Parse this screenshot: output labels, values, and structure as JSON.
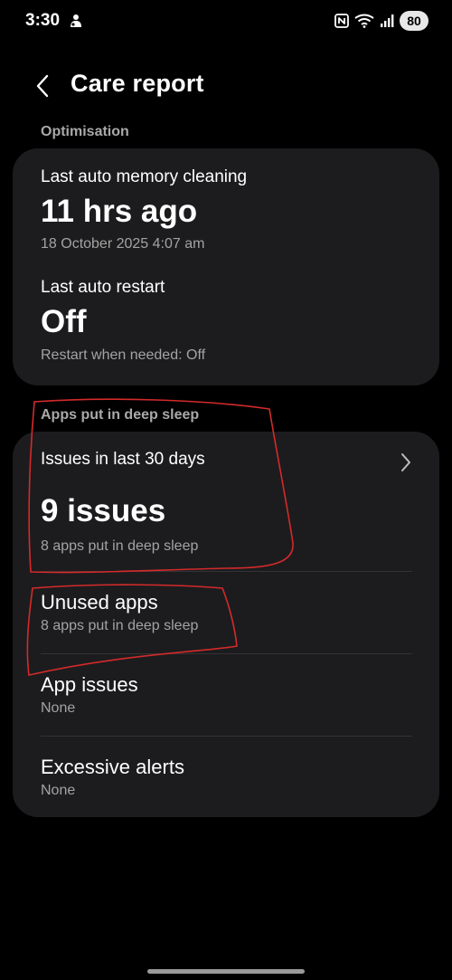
{
  "status_bar": {
    "time": "3:30",
    "left_icon": "notification-icon",
    "nfc_icon": "nfc-icon",
    "wifi_icon": "wifi-icon",
    "signal_icon": "signal-icon",
    "battery": "80"
  },
  "header": {
    "back_icon": "back-arrow-icon",
    "title": "Care report"
  },
  "optimisation": {
    "section_label": "Optimisation",
    "memory_cleaning": {
      "label": "Last auto memory cleaning",
      "value": "11 hrs ago",
      "detail": "18 October 2025 4:07 am"
    },
    "auto_restart": {
      "label": "Last auto restart",
      "value": "Off",
      "detail": "Restart when needed: Off"
    }
  },
  "deep_sleep": {
    "section_label": "Apps put in deep sleep",
    "issues": {
      "label": "Issues in last 30 days",
      "value": "9 issues",
      "detail": "8 apps put in deep sleep",
      "chevron_icon": "chevron-right-icon"
    },
    "items": [
      {
        "title": "Unused apps",
        "subtitle": "8 apps put in deep sleep"
      },
      {
        "title": "App issues",
        "subtitle": "None"
      },
      {
        "title": "Excessive alerts",
        "subtitle": "None"
      }
    ]
  },
  "colors": {
    "background": "#000000",
    "card": "#1c1c1e",
    "annotation": "#d42a2a"
  }
}
